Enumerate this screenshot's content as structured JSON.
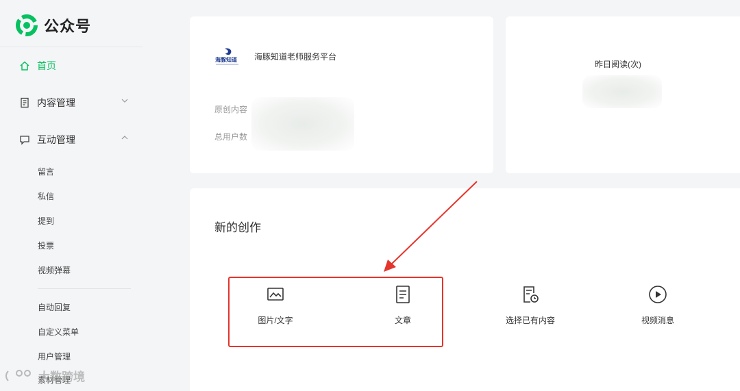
{
  "brand": {
    "name": "公众号",
    "icon": "wechat-official-account-logo",
    "color": "#07c160"
  },
  "sidebar": {
    "home": {
      "label": "首页",
      "icon": "home-icon"
    },
    "content": {
      "label": "内容管理",
      "icon": "document-icon"
    },
    "interaction": {
      "label": "互动管理",
      "icon": "chat-bubble-icon"
    },
    "sub_items": [
      "留言",
      "私信",
      "提到",
      "投票",
      "视频弹幕"
    ],
    "sub_items2": [
      "自动回复",
      "自定义菜单",
      "用户管理",
      "素材管理"
    ]
  },
  "account": {
    "name": "海豚知道老师服务平台",
    "logo_text": "海豚知道",
    "original_label": "原创内容",
    "users_label": "总用户数"
  },
  "stats": {
    "yesterday_reads_label": "昨日阅读(次)"
  },
  "create": {
    "title": "新的创作",
    "options": [
      {
        "label": "图片/文字",
        "icon": "image-text-icon"
      },
      {
        "label": "文章",
        "icon": "article-icon"
      },
      {
        "label": "选择已有内容",
        "icon": "existing-content-icon"
      },
      {
        "label": "视频消息",
        "icon": "video-play-icon"
      }
    ]
  },
  "annotation": {
    "highlight_color": "#e5352c"
  },
  "watermark": {
    "text": "大数跨境"
  }
}
